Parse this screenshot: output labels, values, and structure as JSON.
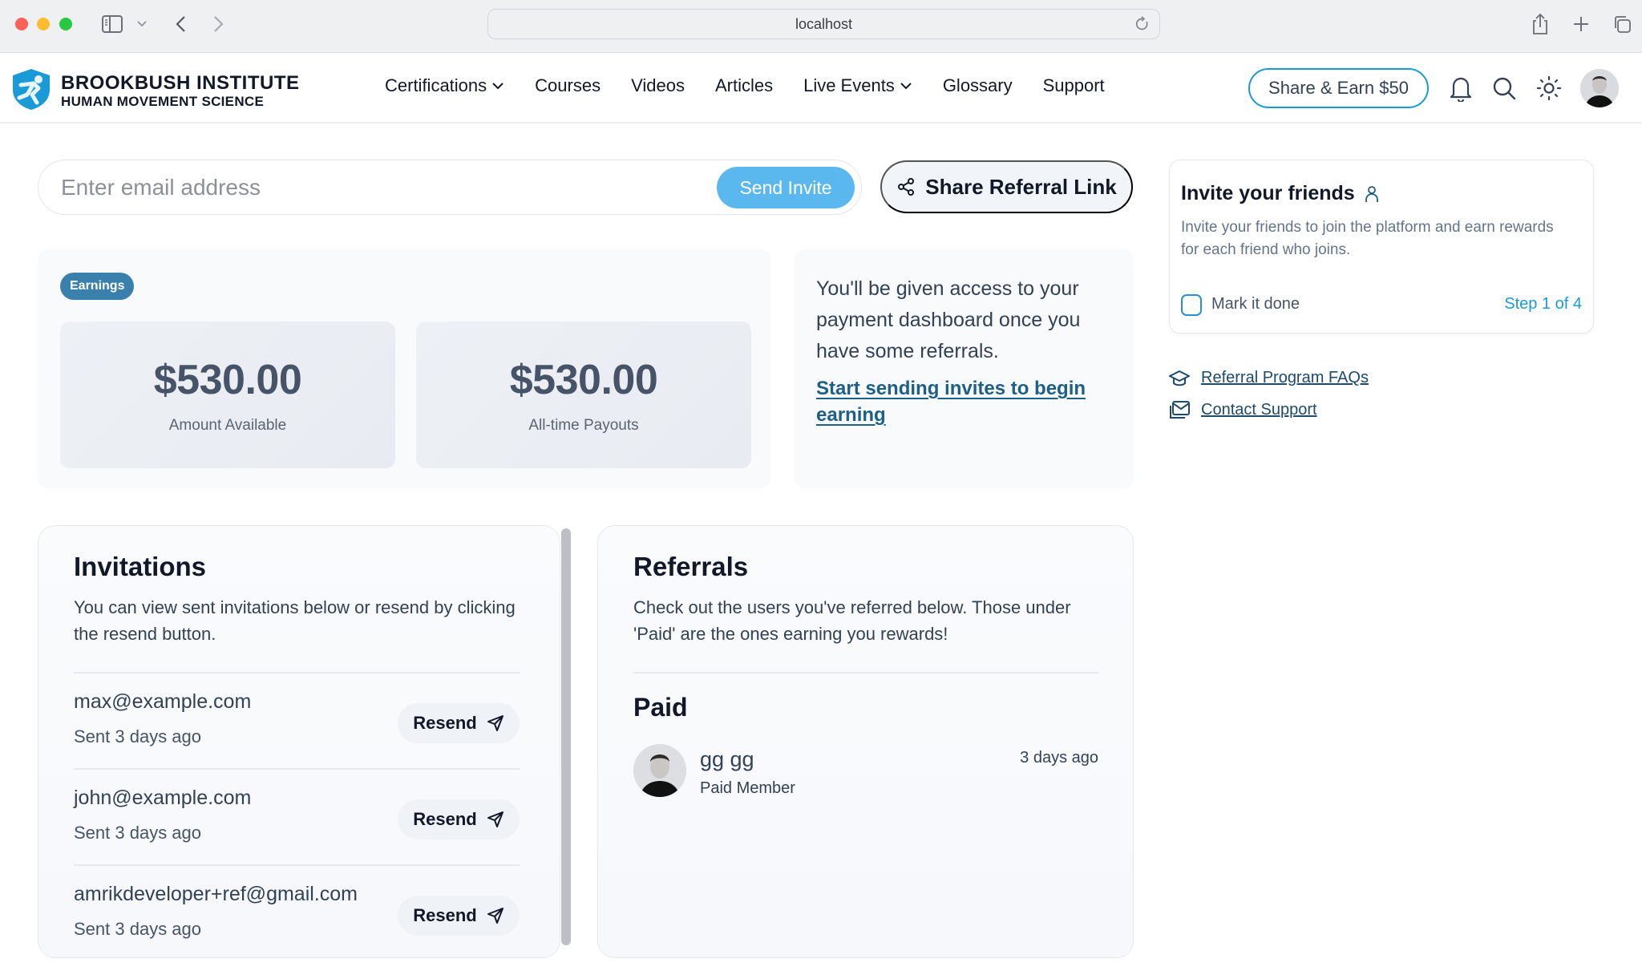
{
  "browser": {
    "url": "localhost",
    "icons": [
      "sidebar-toggle-icon",
      "chevron-down-icon",
      "back-icon",
      "forward-icon",
      "reload-icon",
      "share-icon",
      "new-tab-icon",
      "tabs-overview-icon"
    ]
  },
  "header": {
    "brand_line1": "BROOKBUSH INSTITUTE",
    "brand_line2": "HUMAN MOVEMENT SCIENCE",
    "nav": [
      {
        "label": "Certifications",
        "has_dropdown": true
      },
      {
        "label": "Courses",
        "has_dropdown": false
      },
      {
        "label": "Videos",
        "has_dropdown": false
      },
      {
        "label": "Articles",
        "has_dropdown": false
      },
      {
        "label": "Live Events",
        "has_dropdown": true
      },
      {
        "label": "Glossary",
        "has_dropdown": false
      },
      {
        "label": "Support",
        "has_dropdown": false
      }
    ],
    "share_earn_label": "Share & Earn $50",
    "accent_color": "#1a9ad6"
  },
  "invite": {
    "email_placeholder": "Enter email address",
    "email_value": "",
    "send_label": "Send Invite",
    "share_link_label": "Share Referral Link"
  },
  "earnings": {
    "badge": "Earnings",
    "amount_available": "$530.00",
    "amount_available_label": "Amount Available",
    "all_time_payouts": "$530.00",
    "all_time_payouts_label": "All-time Payouts"
  },
  "access_note": {
    "text": "You'll be given access to your payment dashboard once you have some referrals.",
    "link": "Start sending invites to begin earning"
  },
  "invitations": {
    "title": "Invitations",
    "description": "You can view sent invitations below or resend by clicking the resend button.",
    "resend_label": "Resend",
    "items": [
      {
        "email": "max@example.com",
        "sent": "Sent 3 days ago"
      },
      {
        "email": "john@example.com",
        "sent": "Sent 3 days ago"
      },
      {
        "email": "amrikdeveloper+ref@gmail.com",
        "sent": "Sent 3 days ago"
      }
    ]
  },
  "referrals": {
    "title": "Referrals",
    "description": "Check out the users you've referred below. Those under 'Paid' are the ones earning you rewards!",
    "paid_heading": "Paid",
    "items": [
      {
        "name": "gg gg",
        "status": "Paid Member",
        "time": "3 days ago"
      }
    ]
  },
  "sidebar": {
    "task_title": "Invite your friends",
    "task_description": "Invite your friends to join the platform and earn rewards for each friend who joins.",
    "mark_done_label": "Mark it done",
    "mark_done_checked": false,
    "step_label": "Step 1 of 4",
    "links": [
      {
        "label": "Referral Program FAQs",
        "icon": "graduation-cap-icon"
      },
      {
        "label": "Contact Support",
        "icon": "mail-icon"
      }
    ]
  }
}
